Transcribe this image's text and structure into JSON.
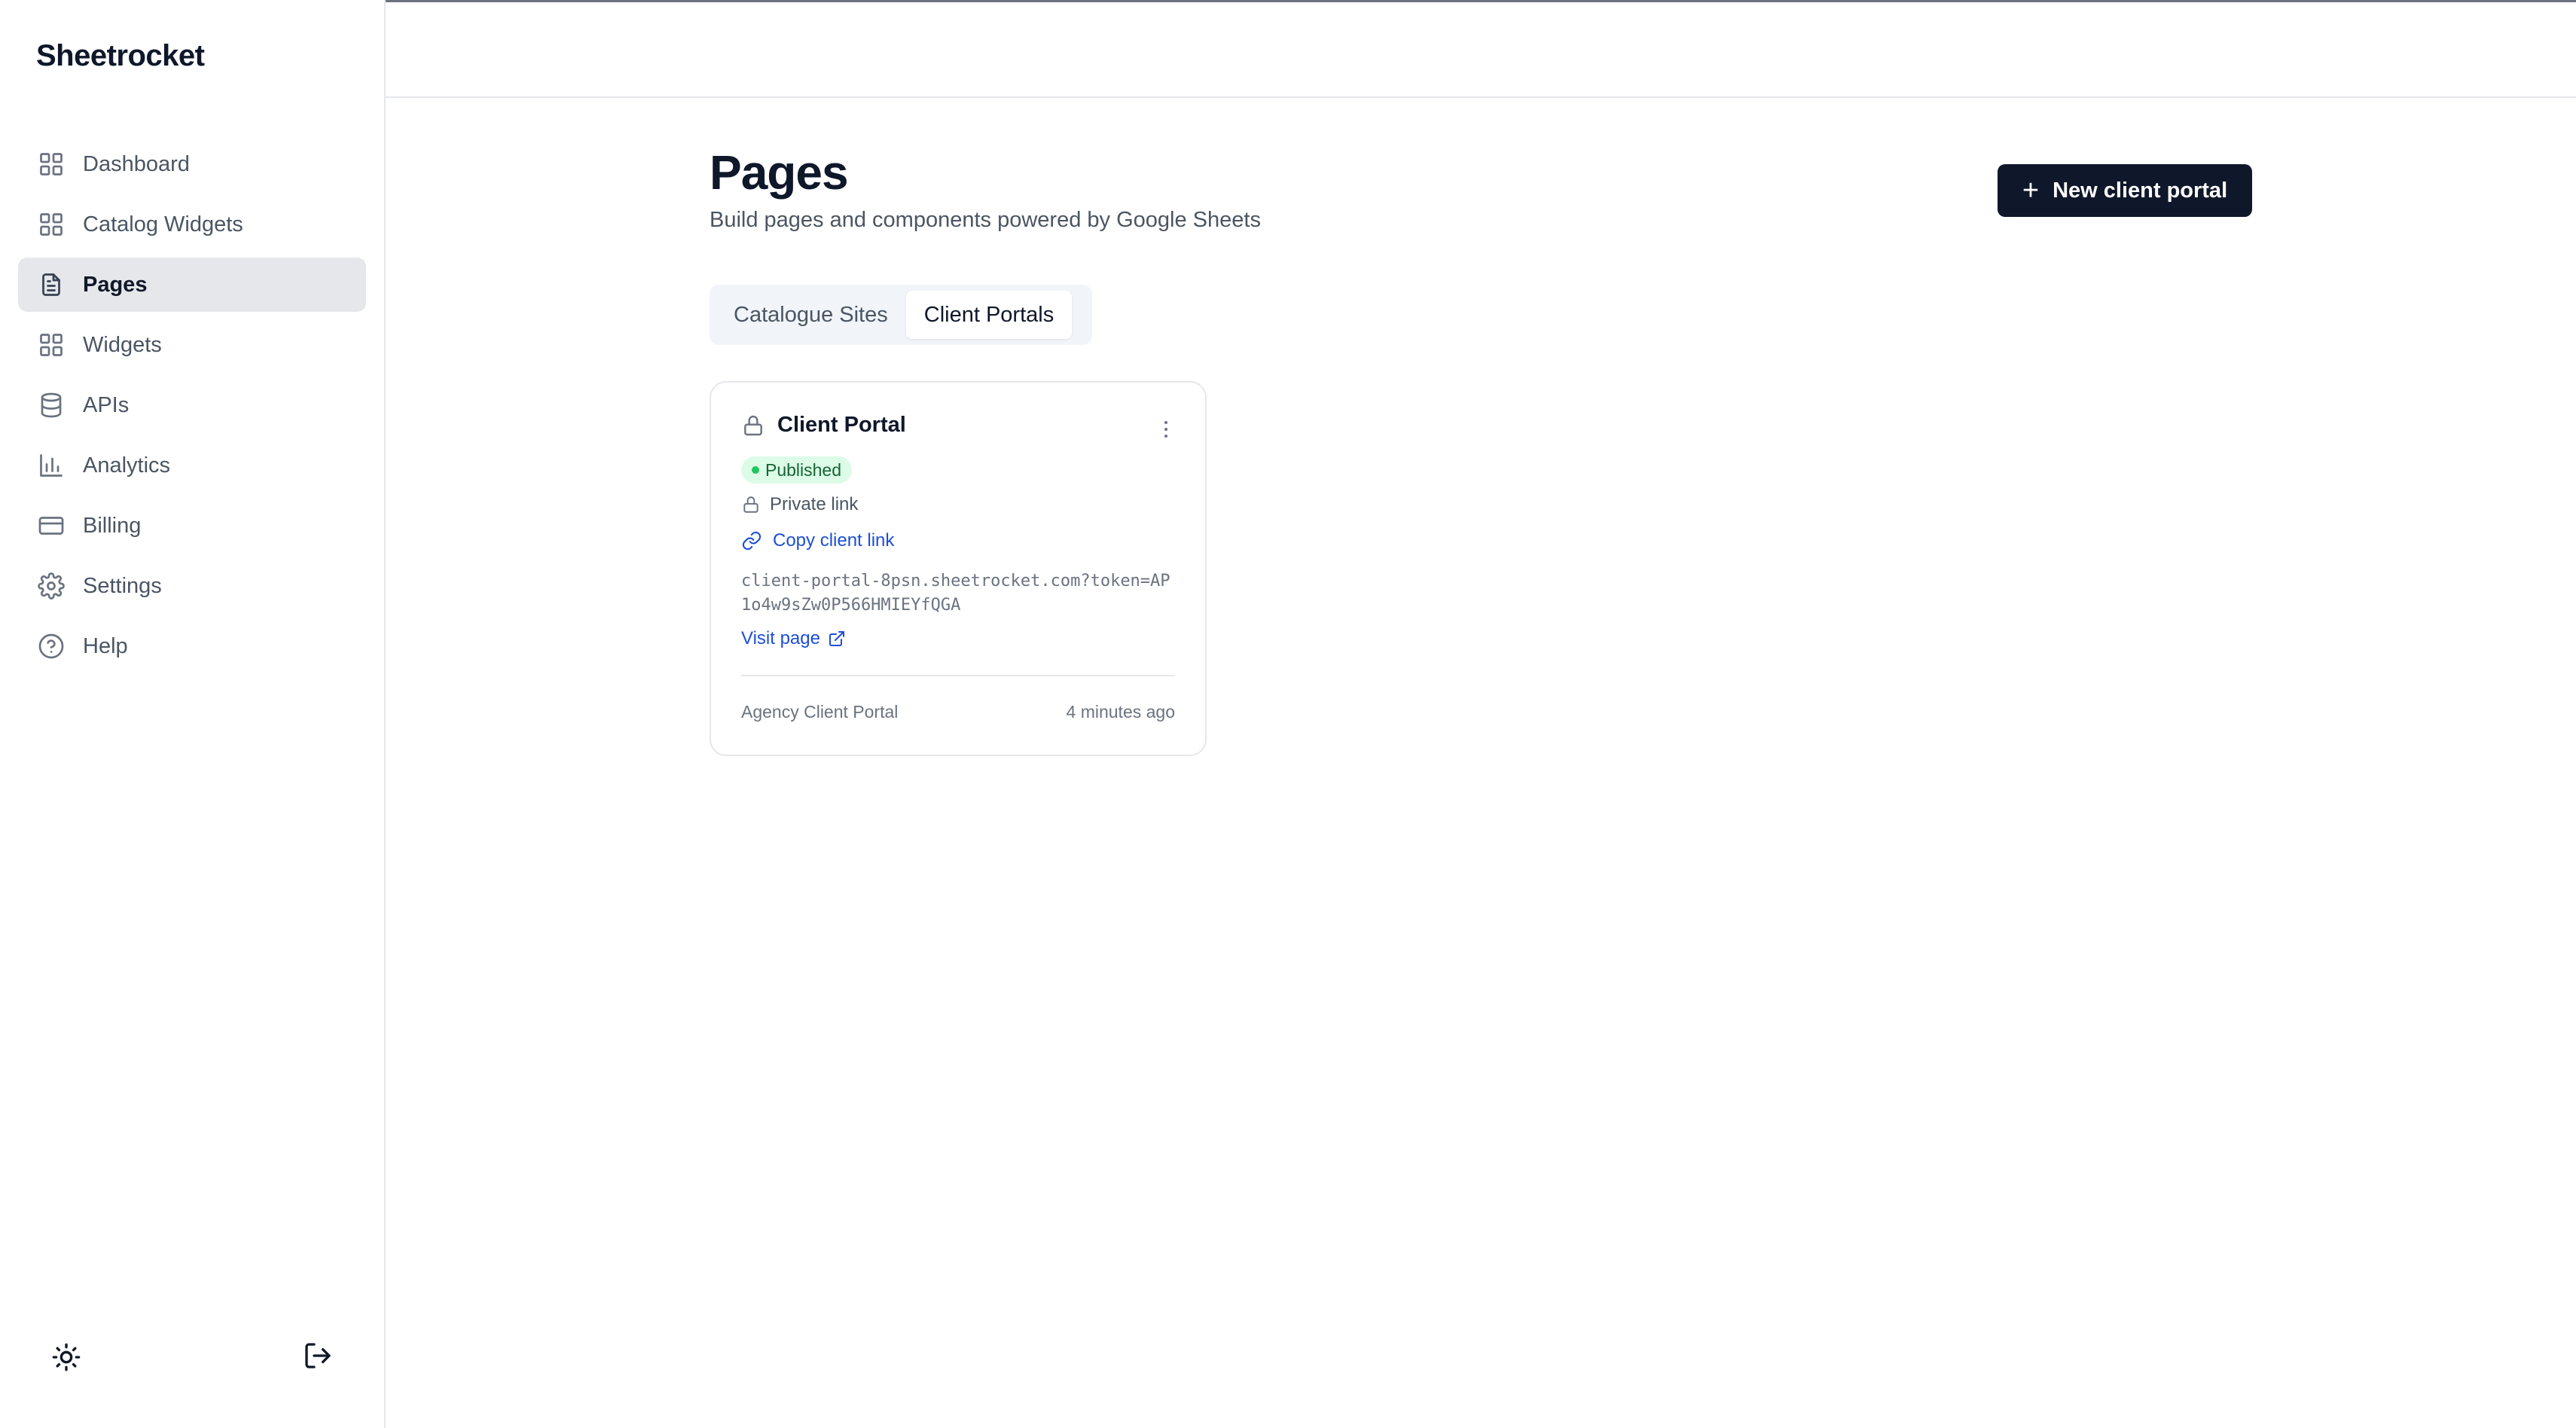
{
  "app": {
    "brand": "Sheetrocket"
  },
  "sidebar": {
    "items": [
      {
        "label": "Dashboard",
        "icon": "grid-icon",
        "active": false
      },
      {
        "label": "Catalog Widgets",
        "icon": "grid-icon",
        "active": false
      },
      {
        "label": "Pages",
        "icon": "file-text-icon",
        "active": true
      },
      {
        "label": "Widgets",
        "icon": "grid-icon",
        "active": false
      },
      {
        "label": "APIs",
        "icon": "database-icon",
        "active": false
      },
      {
        "label": "Analytics",
        "icon": "bar-chart-icon",
        "active": false
      },
      {
        "label": "Billing",
        "icon": "credit-card-icon",
        "active": false
      },
      {
        "label": "Settings",
        "icon": "gear-icon",
        "active": false
      },
      {
        "label": "Help",
        "icon": "help-circle-icon",
        "active": false
      }
    ],
    "footer": {
      "left_icon": "sun-icon",
      "right_icon": "logout-icon"
    }
  },
  "main": {
    "title": "Pages",
    "subtitle": "Build pages and components powered by Google Sheets",
    "new_button_label": "New client portal",
    "tabs": [
      {
        "label": "Catalogue Sites",
        "active": false
      },
      {
        "label": "Client Portals",
        "active": true
      }
    ],
    "cards": [
      {
        "title": "Client Portal",
        "status": "Published",
        "visibility": "Private link",
        "copy_link_label": "Copy client link",
        "url": "client-portal-8psn.sheetrocket.com?token=AP1o4w9sZw0P566HMIEYfQGA",
        "visit_label": "Visit page",
        "template": "Agency Client Portal",
        "updated": "4 minutes ago"
      }
    ]
  },
  "colors": {
    "primary": "#0f172a",
    "link": "#1d4ed8",
    "published_bg": "#dcfce7",
    "published_text": "#166534",
    "active_nav_bg": "#e5e7eb"
  }
}
